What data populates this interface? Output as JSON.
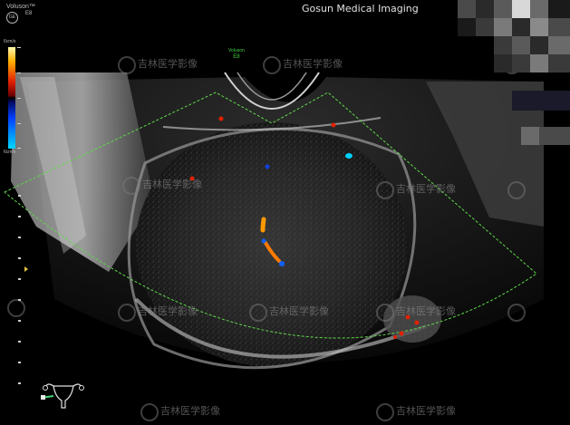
{
  "header": {
    "brand": "Voluson™",
    "probe": "E8",
    "logo": "GE"
  },
  "site_title": "Gosun Medical Imaging",
  "color_bar": {
    "label": "6cm/s",
    "bottom_label": "6cm/s"
  },
  "box_label": {
    "brand": "Voluson",
    "probe": "E8"
  },
  "watermark": "吉林医学影像",
  "colors": {
    "roi_box": "#5fd84a",
    "doppler_red": "#e02000",
    "doppler_orange": "#ff9a00",
    "doppler_blue": "#1060ff",
    "doppler_cyan": "#00d0ff"
  },
  "icons": {
    "logo": "ge-logo",
    "body_mark": "uterus-icon",
    "probe_indicator": "probe-icon"
  }
}
